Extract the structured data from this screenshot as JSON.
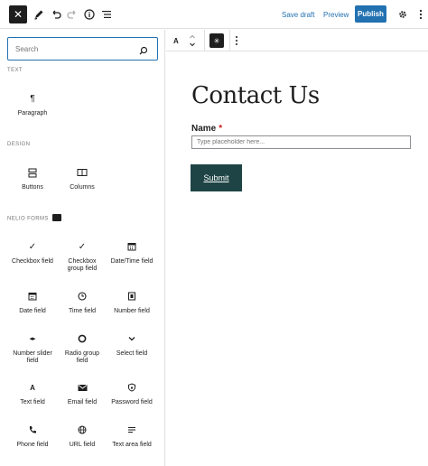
{
  "toolbar": {
    "close_label": "✕",
    "save_draft": "Save draft",
    "preview": "Preview",
    "publish": "Publish",
    "accent": "#2271b1"
  },
  "sidebar": {
    "search_placeholder": "Search",
    "sections": [
      {
        "title": "TEXT",
        "blocks": [
          {
            "label": "Paragraph",
            "icon": "paragraph-icon"
          }
        ]
      },
      {
        "title": "DESIGN",
        "blocks": [
          {
            "label": "Buttons",
            "icon": "buttons-icon"
          },
          {
            "label": "Columns",
            "icon": "columns-icon"
          }
        ]
      },
      {
        "title": "NELIO FORMS",
        "blocks": [
          {
            "label": "Checkbox field",
            "icon": "check-icon"
          },
          {
            "label": "Checkbox group field",
            "icon": "check-icon"
          },
          {
            "label": "Date/Time field",
            "icon": "calendar-icon"
          },
          {
            "label": "Date field",
            "icon": "calendar-icon"
          },
          {
            "label": "Time field",
            "icon": "clock-icon"
          },
          {
            "label": "Number field",
            "icon": "number-icon"
          },
          {
            "label": "Number slider field",
            "icon": "slider-icon"
          },
          {
            "label": "Radio group field",
            "icon": "radio-icon"
          },
          {
            "label": "Select field",
            "icon": "chevron-down-icon"
          },
          {
            "label": "Text field",
            "icon": "text-icon"
          },
          {
            "label": "Email field",
            "icon": "envelope-icon"
          },
          {
            "label": "Password field",
            "icon": "shield-icon"
          },
          {
            "label": "Phone field",
            "icon": "phone-icon"
          },
          {
            "label": "URL field",
            "icon": "globe-icon"
          },
          {
            "label": "Text area field",
            "icon": "textarea-icon"
          }
        ]
      }
    ]
  },
  "block_toolbar": {
    "type_label": "A",
    "star_label": "✳"
  },
  "form": {
    "title": "Contact Us",
    "field_label": "Name",
    "required_mark": "*",
    "placeholder": "Type placeholder here...",
    "submit": "Submit",
    "button_color": "#1e4445"
  }
}
